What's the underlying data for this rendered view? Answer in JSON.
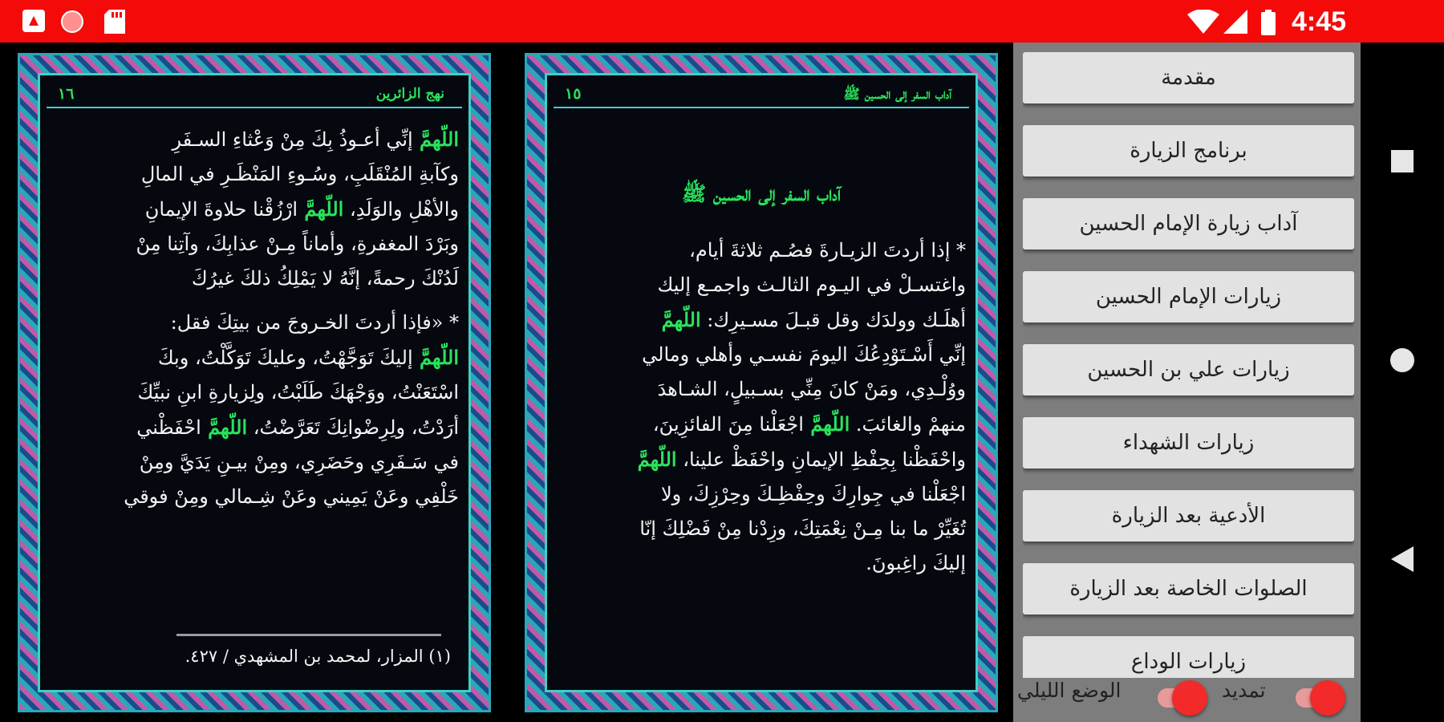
{
  "status_bar": {
    "time": "4:45"
  },
  "left_page": {
    "page_number": "١٦",
    "running_title": "نهج الزائرين",
    "lines": [
      [
        {
          "t": "اللّهمَّ ",
          "g": true
        },
        {
          "t": "إنِّي أعـوذُ بِكَ مِنْ وَعْثاءِ السـفَرِ"
        }
      ],
      [
        {
          "t": "وكآبةِ المُنْقَلَبِ، وسُـوءِ المَنْظَـرِ في المالِ"
        }
      ],
      [
        {
          "t": "والأهْلِ والوَلَدِ، "
        },
        {
          "t": "اللّهمَّ ",
          "g": true
        },
        {
          "t": "ارْزُقْنا حلاوةَ الإيمانِ"
        }
      ],
      [
        {
          "t": "وبَرْدَ المغفرةِ، وأماناً مِـنْ عذابِكَ، وآتِنا مِنْ"
        }
      ],
      [
        {
          "t": "لَدُنْكَ رحمةً، إنَّهُ لا يَمْلِكُ ذلكَ غيرُكَ"
        }
      ],
      [
        {
          "t": "* «فإذا أردتَ الخـروجَ من بيتِكَ فقل:"
        }
      ],
      [
        {
          "t": "اللّهمَّ ",
          "g": true
        },
        {
          "t": "إليكَ تَوَجَّهْتُ، وعليكَ تَوَكَّلْتُ، وبكَ"
        }
      ],
      [
        {
          "t": "اسْتَعَنْتُ، ووَجْهَكَ طَلَبْتُ، ولِزيارةِ ابنِ نبيِّكَ"
        }
      ],
      [
        {
          "t": "أرَدْتُ، ولِرِضْوانِكَ تَعَرَّضْتُ، "
        },
        {
          "t": "اللّهمَّ ",
          "g": true
        },
        {
          "t": "احْفَظْني"
        }
      ],
      [
        {
          "t": "في سَـفَرِي وحَضَرِي، ومِنْ بيـنِ يَدَيَّ ومِنْ"
        }
      ],
      [
        {
          "t": "خَلْفِي وعَنْ يَمِيني وعَنْ شِـمالي ومِنْ فوقي"
        }
      ]
    ],
    "footnote": "(١) المزار، لمحمد بن المشهدي / ٤٢٧."
  },
  "right_page": {
    "page_number": "١٥",
    "running_title": "آداب السفر إلى الحسين ﷺ",
    "chapter_title": "آداب السفر إلى الحسين ﷺ",
    "lines": [
      [
        {
          "t": "* إذا أردتَ الزيـارةَ فصُـم ثلاثةَ أيام،"
        }
      ],
      [
        {
          "t": "واغتسـلْ في اليـوم الثالـث واجمـع إليك"
        }
      ],
      [
        {
          "t": "أهلَـك وولدَك وقل قبـلَ مسـيرِك: "
        },
        {
          "t": "اللّهمَّ",
          "g": true
        }
      ],
      [
        {
          "t": "إنِّي أَسْـتَوْدِعُكَ اليومَ نفسـي وأهلي ومالي"
        }
      ],
      [
        {
          "t": "ووُلْـدِي، ومَنْ كانَ مِنِّي بسـبيلٍ، الشـاهدَ"
        }
      ],
      [
        {
          "t": "منهمْ والغائبَ. "
        },
        {
          "t": "اللّهمَّ ",
          "g": true
        },
        {
          "t": "اجْعَلْنا مِنَ الفائزِينَ،"
        }
      ],
      [
        {
          "t": "واحْفَظْنا بِحِفْظِ الإيمانِ واحْفَظْ علينا، "
        },
        {
          "t": "اللّهمَّ",
          "g": true
        }
      ],
      [
        {
          "t": "اجْعَلْنا في جِوارِكَ وحِفْظِـكَ وحِرْزِكَ، ولا"
        }
      ],
      [
        {
          "t": "تُغَيِّرْ ما بنا مِـنْ نِعْمَتِكَ، وزِدْنا مِنْ فَضْلِكَ إنّا"
        }
      ],
      [
        {
          "t": "إليكَ راغِبونَ."
        }
      ]
    ]
  },
  "menu": {
    "items": [
      "مقدمة",
      "برنامج الزيارة",
      "آداب زيارة الإمام الحسين",
      "زيارات الإمام الحسين",
      "زيارات علي بن الحسين",
      "زيارات الشهداء",
      "الأدعية بعد الزيارة",
      "الصلوات الخاصة بعد الزيارة",
      "زيارات الوداع"
    ],
    "toggles": [
      {
        "label": "تمديد",
        "on": true
      },
      {
        "label": "الوضع الليلي",
        "on": true
      }
    ]
  },
  "colors": {
    "status_bar": "#f50a0a",
    "highlight": "#29e35c",
    "page_bg": "#060810",
    "toggle_on": "#f22a2a"
  },
  "icons": [
    "android-icon",
    "record-icon",
    "sd-card-icon",
    "wifi-icon",
    "signal-icon",
    "battery-icon",
    "recents-icon",
    "home-icon",
    "back-icon"
  ]
}
